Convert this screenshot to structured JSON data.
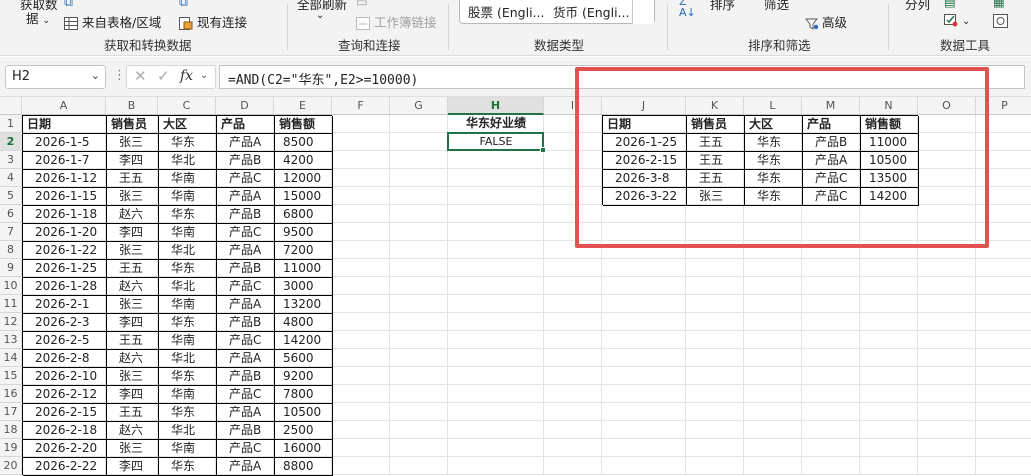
{
  "ribbon": {
    "get_data": "获取数",
    "get_data_2": "据",
    "from_table": "来自表格/区域",
    "existing_conn": "现有连接",
    "refresh_all": "全部刷新",
    "workbook_links": "工作簿链接",
    "stocks": "股票 (Engli...",
    "currency": "货币 (Engli...",
    "sort": "排序",
    "filter": "筛选",
    "advanced": "高级",
    "text_to_cols": "分列",
    "groups": [
      "获取和转换数据",
      "查询和连接",
      "数据类型",
      "排序和筛选",
      "数据工具"
    ]
  },
  "formula_bar": {
    "name_box": "H2",
    "fx": "fx",
    "formula": "=AND(C2=\"华东\",E2>=10000)"
  },
  "columns": [
    "A",
    "B",
    "C",
    "D",
    "E",
    "F",
    "G",
    "H",
    "I",
    "J",
    "K",
    "L",
    "M",
    "N",
    "O",
    "P"
  ],
  "selected_column": "H",
  "selected_row": "2",
  "main_table": {
    "headers": [
      "日期",
      "销售员",
      "大区",
      "产品",
      "销售额"
    ],
    "rows": [
      [
        "2026-1-5",
        "张三",
        "华东",
        "产品A",
        "8500"
      ],
      [
        "2026-1-7",
        "李四",
        "华北",
        "产品B",
        "4200"
      ],
      [
        "2026-1-12",
        "王五",
        "华南",
        "产品C",
        "12000"
      ],
      [
        "2026-1-15",
        "张三",
        "华南",
        "产品A",
        "15000"
      ],
      [
        "2026-1-18",
        "赵六",
        "华东",
        "产品B",
        "6800"
      ],
      [
        "2026-1-20",
        "李四",
        "华南",
        "产品C",
        "9500"
      ],
      [
        "2026-1-22",
        "张三",
        "华北",
        "产品A",
        "7200"
      ],
      [
        "2026-1-25",
        "王五",
        "华东",
        "产品B",
        "11000"
      ],
      [
        "2026-1-28",
        "赵六",
        "华北",
        "产品C",
        "3000"
      ],
      [
        "2026-2-1",
        "张三",
        "华南",
        "产品A",
        "13200"
      ],
      [
        "2026-2-3",
        "李四",
        "华东",
        "产品B",
        "4800"
      ],
      [
        "2026-2-5",
        "王五",
        "华南",
        "产品C",
        "14200"
      ],
      [
        "2026-2-8",
        "赵六",
        "华北",
        "产品A",
        "5600"
      ],
      [
        "2026-2-10",
        "张三",
        "华东",
        "产品B",
        "9200"
      ],
      [
        "2026-2-12",
        "李四",
        "华南",
        "产品C",
        "7800"
      ],
      [
        "2026-2-15",
        "王五",
        "华东",
        "产品A",
        "10500"
      ],
      [
        "2026-2-18",
        "赵六",
        "华北",
        "产品B",
        "2500"
      ],
      [
        "2026-2-20",
        "张三",
        "华南",
        "产品C",
        "16000"
      ],
      [
        "2026-2-22",
        "李四",
        "华东",
        "产品A",
        "8800"
      ]
    ]
  },
  "criteria": {
    "header": "华东好业绩",
    "value": "FALSE"
  },
  "result_table": {
    "headers": [
      "日期",
      "销售员",
      "大区",
      "产品",
      "销售额"
    ],
    "rows": [
      [
        "2026-1-25",
        "王五",
        "华东",
        "产品B",
        "11000"
      ],
      [
        "2026-2-15",
        "王五",
        "华东",
        "产品A",
        "10500"
      ],
      [
        "2026-3-8",
        "王五",
        "华东",
        "产品C",
        "13500"
      ],
      [
        "2026-3-22",
        "张三",
        "华东",
        "产品C",
        "14200"
      ]
    ]
  },
  "colors": {
    "accent": "#217346",
    "highlight_box": "#e35151"
  }
}
